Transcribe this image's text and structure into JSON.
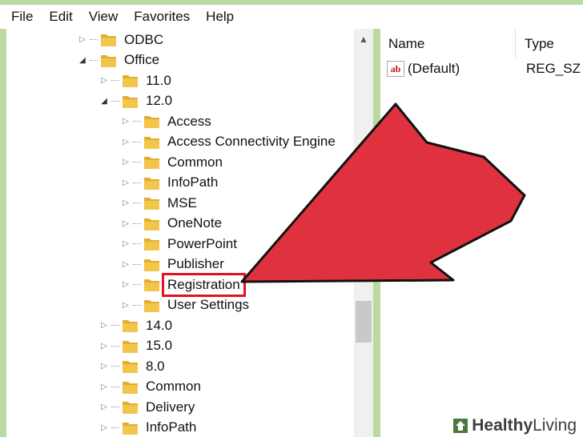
{
  "menu": [
    "File",
    "Edit",
    "View",
    "Favorites",
    "Help"
  ],
  "tree": [
    {
      "label": "ODBC",
      "indent": 0,
      "expander": "collapsed"
    },
    {
      "label": "Office",
      "indent": 0,
      "expander": "expanded"
    },
    {
      "label": "11.0",
      "indent": 1,
      "expander": "collapsed"
    },
    {
      "label": "12.0",
      "indent": 1,
      "expander": "expanded"
    },
    {
      "label": "Access",
      "indent": 2,
      "expander": "collapsed"
    },
    {
      "label": "Access Connectivity Engine",
      "indent": 2,
      "expander": "collapsed"
    },
    {
      "label": "Common",
      "indent": 2,
      "expander": "collapsed"
    },
    {
      "label": "InfoPath",
      "indent": 2,
      "expander": "collapsed"
    },
    {
      "label": "MSE",
      "indent": 2,
      "expander": "collapsed"
    },
    {
      "label": "OneNote",
      "indent": 2,
      "expander": "collapsed"
    },
    {
      "label": "PowerPoint",
      "indent": 2,
      "expander": "collapsed"
    },
    {
      "label": "Publisher",
      "indent": 2,
      "expander": "collapsed"
    },
    {
      "label": "Registration",
      "indent": 2,
      "expander": "collapsed",
      "highlighted": true
    },
    {
      "label": "User Settings",
      "indent": 2,
      "expander": "collapsed"
    },
    {
      "label": "14.0",
      "indent": 1,
      "expander": "collapsed"
    },
    {
      "label": "15.0",
      "indent": 1,
      "expander": "collapsed"
    },
    {
      "label": "8.0",
      "indent": 1,
      "expander": "collapsed"
    },
    {
      "label": "Common",
      "indent": 1,
      "expander": "collapsed"
    },
    {
      "label": "Delivery",
      "indent": 1,
      "expander": "collapsed"
    },
    {
      "label": "InfoPath",
      "indent": 1,
      "expander": "collapsed"
    }
  ],
  "list": {
    "headers": {
      "name": "Name",
      "type": "Type"
    },
    "rows": [
      {
        "name": "(Default)",
        "type": "REG_SZ",
        "icon": "string-value-icon"
      }
    ]
  },
  "colors": {
    "arrow": "#e0313f",
    "highlight_box": "#e0131f",
    "background": "#bcd9a2",
    "folder": "#f2c54b"
  },
  "watermark": {
    "bold": "Healthy",
    "regular": "Living"
  }
}
